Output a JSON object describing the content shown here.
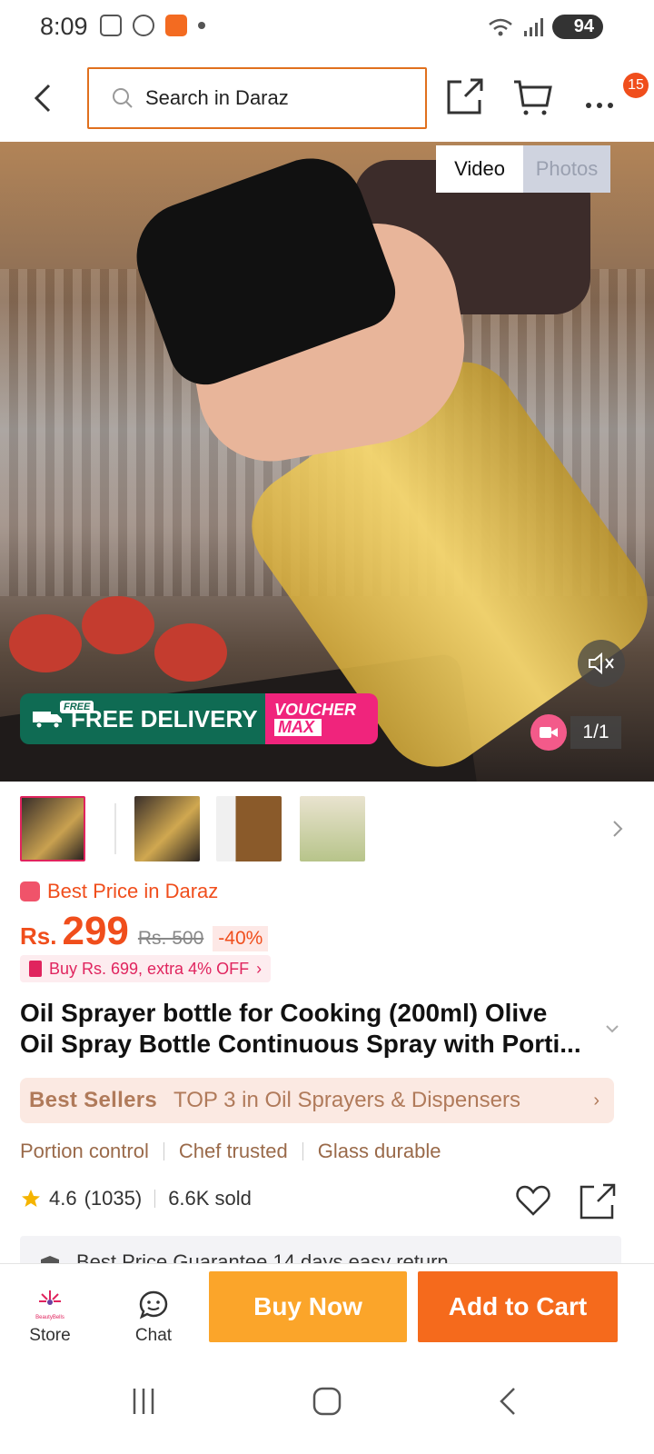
{
  "status_bar": {
    "time": "8:09",
    "battery": "94"
  },
  "header": {
    "search_placeholder": "Search in Daraz",
    "cart_badge": "15"
  },
  "gallery": {
    "tabs": [
      {
        "label": "Video",
        "active": true
      },
      {
        "label": "Photos",
        "active": false
      }
    ],
    "counter": "1/1",
    "free_delivery": "FREE DELIVERY",
    "free_tag": "FREE",
    "voucher_line1": "VOUCHER",
    "voucher_line2": "MAX"
  },
  "product": {
    "best_price_label": "Best Price in Daraz",
    "currency": "Rs.",
    "price": "299",
    "original_price": "Rs. 500",
    "discount": "-40%",
    "promo": "Buy Rs. 699, extra 4% OFF",
    "title": "Oil Sprayer bottle for Cooking (200ml) Olive Oil Spray Bottle Continuous Spray with Porti...",
    "best_sellers_label": "Best Sellers",
    "best_sellers_text": "TOP 3 in Oil Sprayers & Dispensers",
    "features": [
      "Portion control",
      "Chef trusted",
      "Glass durable"
    ],
    "rating": "4.6",
    "review_count": "(1035)",
    "sold": "6.6K sold",
    "guarantee_text": "Best Price Guarantee   14 days easy return"
  },
  "bottom_bar": {
    "store_label": "Store",
    "store_logo_text": "BeautyBells",
    "chat_label": "Chat",
    "buy_now": "Buy Now",
    "add_to_cart": "Add to Cart"
  },
  "colors": {
    "brand_orange": "#f56a1c",
    "buy_now": "#fba52a",
    "price": "#f04e1c",
    "accent_pink": "#e0245e"
  }
}
